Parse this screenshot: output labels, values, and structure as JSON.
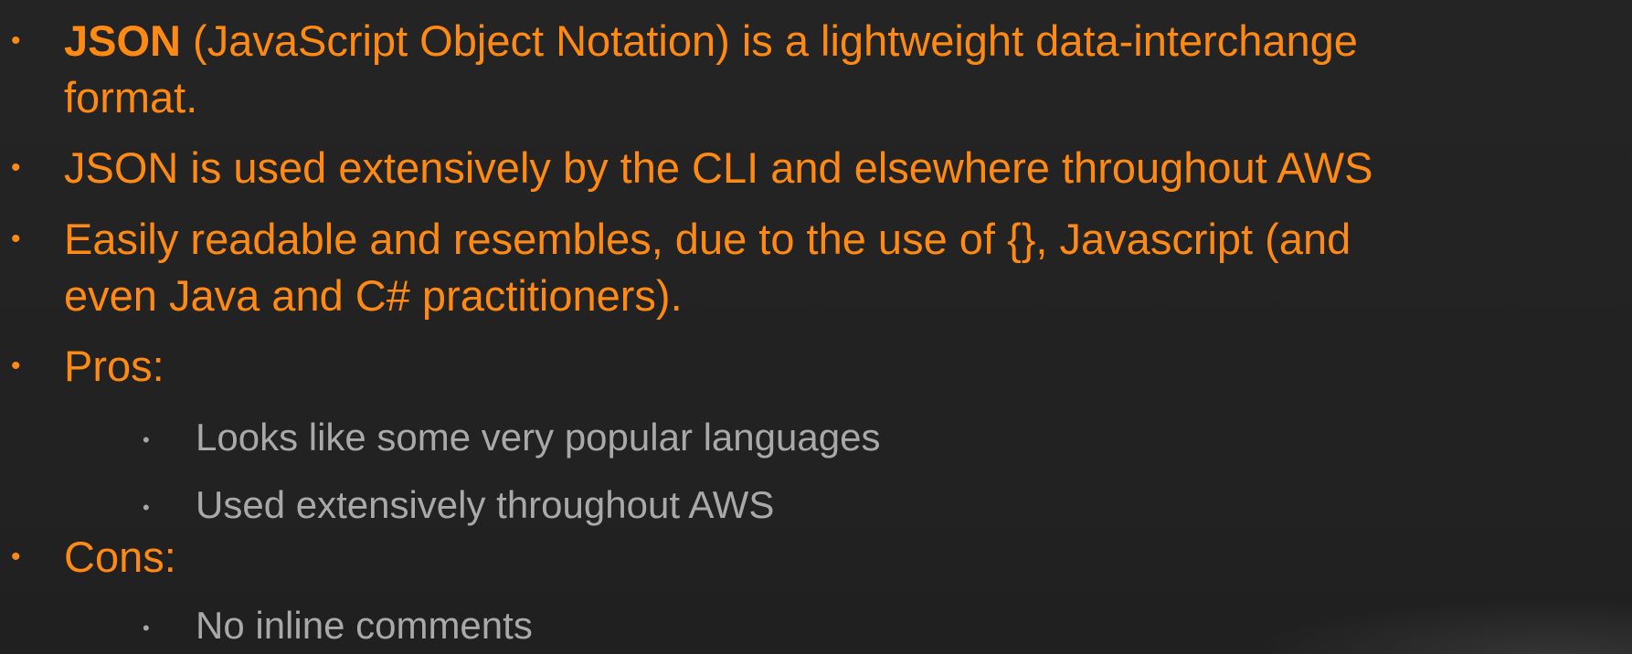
{
  "slide": {
    "items": [
      {
        "level": 1,
        "bold_prefix": "JSON",
        "text_line1": " (JavaScript Object Notation) is a lightweight data-interchange",
        "text_line2": "format."
      },
      {
        "level": 1,
        "text": "JSON is used extensively by the CLI and elsewhere throughout AWS"
      },
      {
        "level": 1,
        "text_line1": "Easily readable and resembles, due to the use of {}, Javascript (and",
        "text_line2": "even Java and C# practitioners)."
      },
      {
        "level": 1,
        "text": "Pros:"
      },
      {
        "level": 2,
        "text": "Looks like some very popular languages"
      },
      {
        "level": 2,
        "text": "Used extensively throughout AWS"
      },
      {
        "level": 1,
        "text": "Cons:"
      },
      {
        "level": 2,
        "text": "No inline comments"
      }
    ],
    "bullet_glyph": "•",
    "colors": {
      "background": "#232323",
      "primary_text": "#ff8a13",
      "secondary_text": "#a9a9a9"
    }
  }
}
